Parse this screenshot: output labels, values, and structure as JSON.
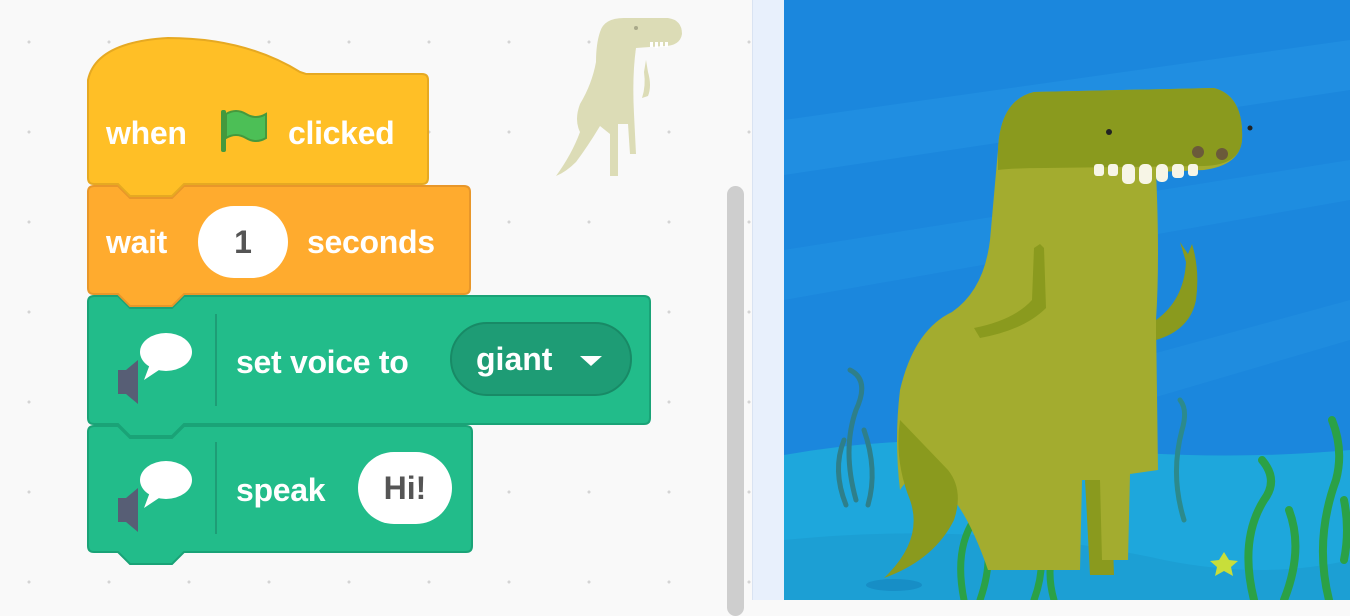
{
  "workspace": {
    "event_block": {
      "when_label": "when",
      "clicked_label": "clicked",
      "flag_icon": "green-flag-icon",
      "color": "#ffbf26"
    },
    "wait_block": {
      "wait_label": "wait",
      "value": "1",
      "seconds_label": "seconds",
      "color": "#ffab2e"
    },
    "set_voice_block": {
      "label": "set voice to",
      "voice_value": "giant",
      "icon": "text-to-speech-icon",
      "color": "#22bc8a"
    },
    "speak_block": {
      "label": "speak",
      "value": "Hi!",
      "icon": "text-to-speech-icon",
      "color": "#22bc8a"
    },
    "sprite_thumbnail": "dinosaur-sprite-icon"
  },
  "stage": {
    "sprite": "dinosaur-sprite",
    "backdrop": "underwater-backdrop",
    "water_color": "#1b87dd",
    "seabed_color": "#1ea7dc"
  }
}
